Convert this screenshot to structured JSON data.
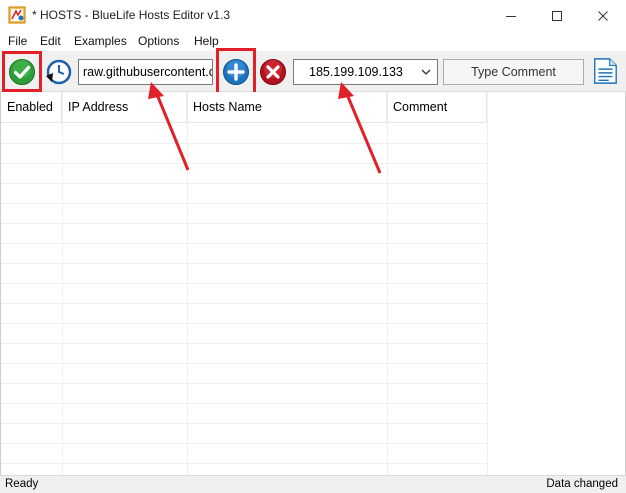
{
  "window": {
    "title": "* HOSTS - BlueLife Hosts Editor v1.3",
    "icon": "app-icon"
  },
  "menu": {
    "items": [
      "File",
      "Edit",
      "Examples",
      "Options",
      "Help"
    ]
  },
  "toolbar": {
    "save_icon": "checkmark-icon",
    "restore_icon": "clock-restore-icon",
    "hostname_value": "raw.githubusercontent.com",
    "add_icon": "plus-icon",
    "delete_icon": "delete-x-icon",
    "ip_value": "185.199.109.133",
    "comment_placeholder": "Type Comment",
    "notes_icon": "document-icon"
  },
  "table": {
    "columns": [
      "Enabled",
      "IP Address",
      "Hosts Name",
      "Comment"
    ],
    "rows": []
  },
  "status": {
    "left": "Ready",
    "right": "Data changed"
  },
  "colors": {
    "highlight": "#e0212a",
    "accent": "#1e73be"
  }
}
